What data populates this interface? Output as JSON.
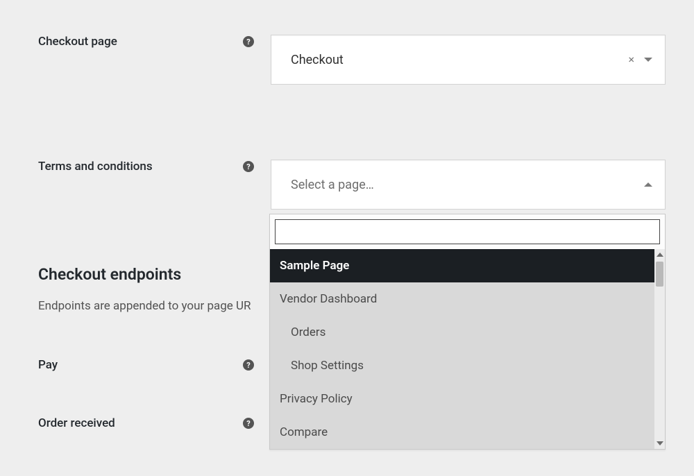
{
  "fields": {
    "checkout_page": {
      "label": "Checkout page",
      "value": "Checkout"
    },
    "terms": {
      "label": "Terms and conditions",
      "placeholder": "Select a page…"
    },
    "pay": {
      "label": "Pay"
    },
    "order_received": {
      "label": "Order received"
    }
  },
  "section": {
    "heading": "Checkout endpoints",
    "desc_truncated": "Endpoints are appended to your page UR"
  },
  "dropdown": {
    "search_value": "",
    "options": [
      {
        "label": "Sample Page",
        "highlight": true,
        "indent": false
      },
      {
        "label": "Vendor Dashboard",
        "highlight": false,
        "indent": false
      },
      {
        "label": "Orders",
        "highlight": false,
        "indent": true
      },
      {
        "label": "Shop Settings",
        "highlight": false,
        "indent": true
      },
      {
        "label": "Privacy Policy",
        "highlight": false,
        "indent": false
      },
      {
        "label": "Compare",
        "highlight": false,
        "indent": false
      }
    ]
  }
}
